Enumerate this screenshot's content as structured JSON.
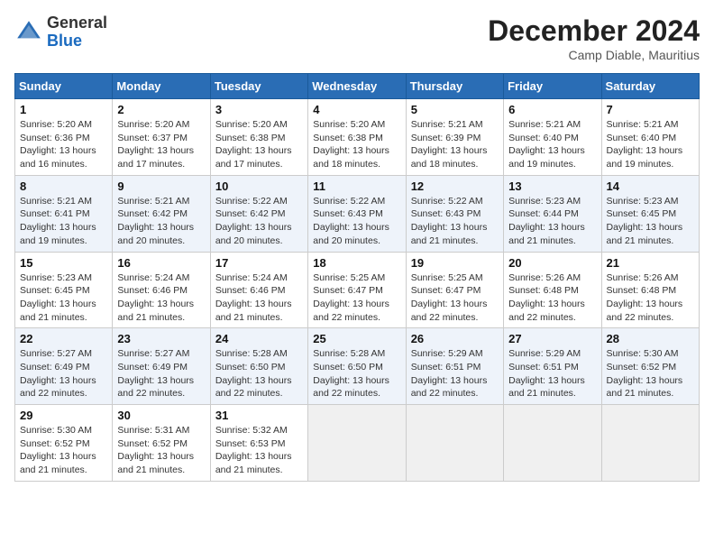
{
  "header": {
    "logo_line1": "General",
    "logo_line2": "Blue",
    "month": "December 2024",
    "location": "Camp Diable, Mauritius"
  },
  "weekdays": [
    "Sunday",
    "Monday",
    "Tuesday",
    "Wednesday",
    "Thursday",
    "Friday",
    "Saturday"
  ],
  "weeks": [
    [
      {
        "day": "1",
        "sunrise": "5:20 AM",
        "sunset": "6:36 PM",
        "daylight": "13 hours and 16 minutes."
      },
      {
        "day": "2",
        "sunrise": "5:20 AM",
        "sunset": "6:37 PM",
        "daylight": "13 hours and 17 minutes."
      },
      {
        "day": "3",
        "sunrise": "5:20 AM",
        "sunset": "6:38 PM",
        "daylight": "13 hours and 17 minutes."
      },
      {
        "day": "4",
        "sunrise": "5:20 AM",
        "sunset": "6:38 PM",
        "daylight": "13 hours and 18 minutes."
      },
      {
        "day": "5",
        "sunrise": "5:21 AM",
        "sunset": "6:39 PM",
        "daylight": "13 hours and 18 minutes."
      },
      {
        "day": "6",
        "sunrise": "5:21 AM",
        "sunset": "6:40 PM",
        "daylight": "13 hours and 19 minutes."
      },
      {
        "day": "7",
        "sunrise": "5:21 AM",
        "sunset": "6:40 PM",
        "daylight": "13 hours and 19 minutes."
      }
    ],
    [
      {
        "day": "8",
        "sunrise": "5:21 AM",
        "sunset": "6:41 PM",
        "daylight": "13 hours and 19 minutes."
      },
      {
        "day": "9",
        "sunrise": "5:21 AM",
        "sunset": "6:42 PM",
        "daylight": "13 hours and 20 minutes."
      },
      {
        "day": "10",
        "sunrise": "5:22 AM",
        "sunset": "6:42 PM",
        "daylight": "13 hours and 20 minutes."
      },
      {
        "day": "11",
        "sunrise": "5:22 AM",
        "sunset": "6:43 PM",
        "daylight": "13 hours and 20 minutes."
      },
      {
        "day": "12",
        "sunrise": "5:22 AM",
        "sunset": "6:43 PM",
        "daylight": "13 hours and 21 minutes."
      },
      {
        "day": "13",
        "sunrise": "5:23 AM",
        "sunset": "6:44 PM",
        "daylight": "13 hours and 21 minutes."
      },
      {
        "day": "14",
        "sunrise": "5:23 AM",
        "sunset": "6:45 PM",
        "daylight": "13 hours and 21 minutes."
      }
    ],
    [
      {
        "day": "15",
        "sunrise": "5:23 AM",
        "sunset": "6:45 PM",
        "daylight": "13 hours and 21 minutes."
      },
      {
        "day": "16",
        "sunrise": "5:24 AM",
        "sunset": "6:46 PM",
        "daylight": "13 hours and 21 minutes."
      },
      {
        "day": "17",
        "sunrise": "5:24 AM",
        "sunset": "6:46 PM",
        "daylight": "13 hours and 21 minutes."
      },
      {
        "day": "18",
        "sunrise": "5:25 AM",
        "sunset": "6:47 PM",
        "daylight": "13 hours and 22 minutes."
      },
      {
        "day": "19",
        "sunrise": "5:25 AM",
        "sunset": "6:47 PM",
        "daylight": "13 hours and 22 minutes."
      },
      {
        "day": "20",
        "sunrise": "5:26 AM",
        "sunset": "6:48 PM",
        "daylight": "13 hours and 22 minutes."
      },
      {
        "day": "21",
        "sunrise": "5:26 AM",
        "sunset": "6:48 PM",
        "daylight": "13 hours and 22 minutes."
      }
    ],
    [
      {
        "day": "22",
        "sunrise": "5:27 AM",
        "sunset": "6:49 PM",
        "daylight": "13 hours and 22 minutes."
      },
      {
        "day": "23",
        "sunrise": "5:27 AM",
        "sunset": "6:49 PM",
        "daylight": "13 hours and 22 minutes."
      },
      {
        "day": "24",
        "sunrise": "5:28 AM",
        "sunset": "6:50 PM",
        "daylight": "13 hours and 22 minutes."
      },
      {
        "day": "25",
        "sunrise": "5:28 AM",
        "sunset": "6:50 PM",
        "daylight": "13 hours and 22 minutes."
      },
      {
        "day": "26",
        "sunrise": "5:29 AM",
        "sunset": "6:51 PM",
        "daylight": "13 hours and 22 minutes."
      },
      {
        "day": "27",
        "sunrise": "5:29 AM",
        "sunset": "6:51 PM",
        "daylight": "13 hours and 21 minutes."
      },
      {
        "day": "28",
        "sunrise": "5:30 AM",
        "sunset": "6:52 PM",
        "daylight": "13 hours and 21 minutes."
      }
    ],
    [
      {
        "day": "29",
        "sunrise": "5:30 AM",
        "sunset": "6:52 PM",
        "daylight": "13 hours and 21 minutes."
      },
      {
        "day": "30",
        "sunrise": "5:31 AM",
        "sunset": "6:52 PM",
        "daylight": "13 hours and 21 minutes."
      },
      {
        "day": "31",
        "sunrise": "5:32 AM",
        "sunset": "6:53 PM",
        "daylight": "13 hours and 21 minutes."
      },
      null,
      null,
      null,
      null
    ]
  ]
}
